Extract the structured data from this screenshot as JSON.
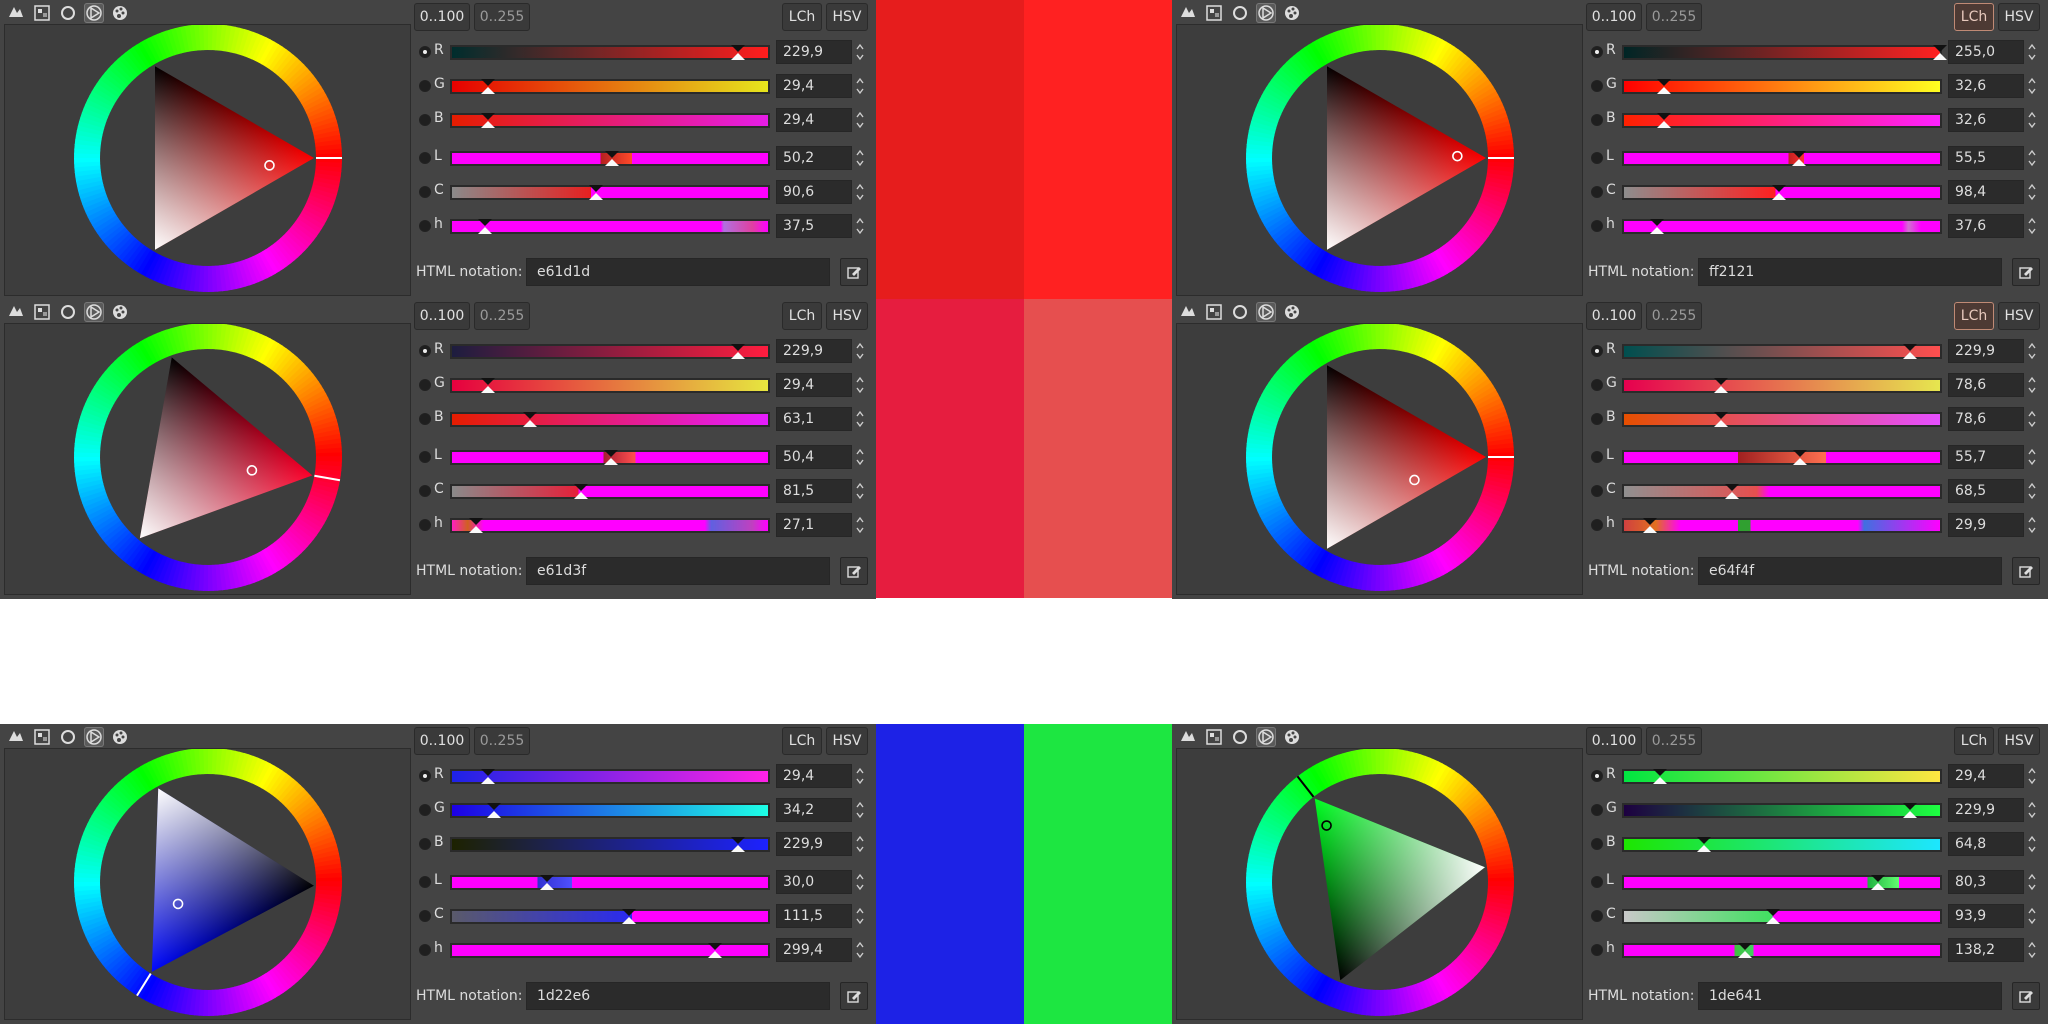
{
  "common": {
    "scale_100": "0..100",
    "scale_255": "0..255",
    "lch": "LCh",
    "hsv": "HSV",
    "html_label": "HTML notation:",
    "channels": [
      "R",
      "G",
      "B",
      "L",
      "C",
      "h"
    ]
  },
  "swatch_colors": [
    "#e61d1d",
    "#ff2121",
    "#e61d3f",
    "#e64f4f",
    "#1d22e6",
    "#1de641"
  ],
  "panels": [
    {
      "id": "red-a",
      "hue": 0,
      "lch_active": false,
      "values": [
        "229,9",
        "29,4",
        "29,4",
        "50,2",
        "90,6",
        "37,5"
      ],
      "positions": [
        0.905,
        0.115,
        0.115,
        0.505,
        0.455,
        0.105
      ],
      "hex": "e61d1d"
    },
    {
      "id": "red-b",
      "hue": 0,
      "lch_active": true,
      "values": [
        "255,0",
        "32,6",
        "32,6",
        "55,5",
        "98,4",
        "37,6"
      ],
      "positions": [
        1.0,
        0.128,
        0.128,
        0.555,
        0.49,
        0.105
      ],
      "hex": "ff2121"
    },
    {
      "id": "crimson",
      "hue": 350,
      "lch_active": false,
      "values": [
        "229,9",
        "29,4",
        "63,1",
        "50,4",
        "81,5",
        "27,1"
      ],
      "positions": [
        0.905,
        0.115,
        0.247,
        0.504,
        0.408,
        0.075
      ],
      "hex": "e61d3f"
    },
    {
      "id": "salmon",
      "hue": 0,
      "lch_active": true,
      "values": [
        "229,9",
        "78,6",
        "78,6",
        "55,7",
        "68,5",
        "29,9"
      ],
      "positions": [
        0.905,
        0.308,
        0.308,
        0.557,
        0.342,
        0.083
      ],
      "hex": "e64f4f"
    },
    {
      "id": "blue",
      "hue": 238,
      "lch_active": false,
      "values": [
        "29,4",
        "34,2",
        "229,9",
        "30,0",
        "111,5",
        "299,4"
      ],
      "positions": [
        0.115,
        0.134,
        0.905,
        0.3,
        0.56,
        0.832
      ],
      "hex": "1d22e6"
    },
    {
      "id": "green",
      "hue": 128,
      "lch_active": false,
      "values": [
        "29,4",
        "229,9",
        "64,8",
        "80,3",
        "93,9",
        "138,2"
      ],
      "positions": [
        0.115,
        0.905,
        0.254,
        0.803,
        0.47,
        0.384
      ],
      "hex": "1de641"
    }
  ]
}
